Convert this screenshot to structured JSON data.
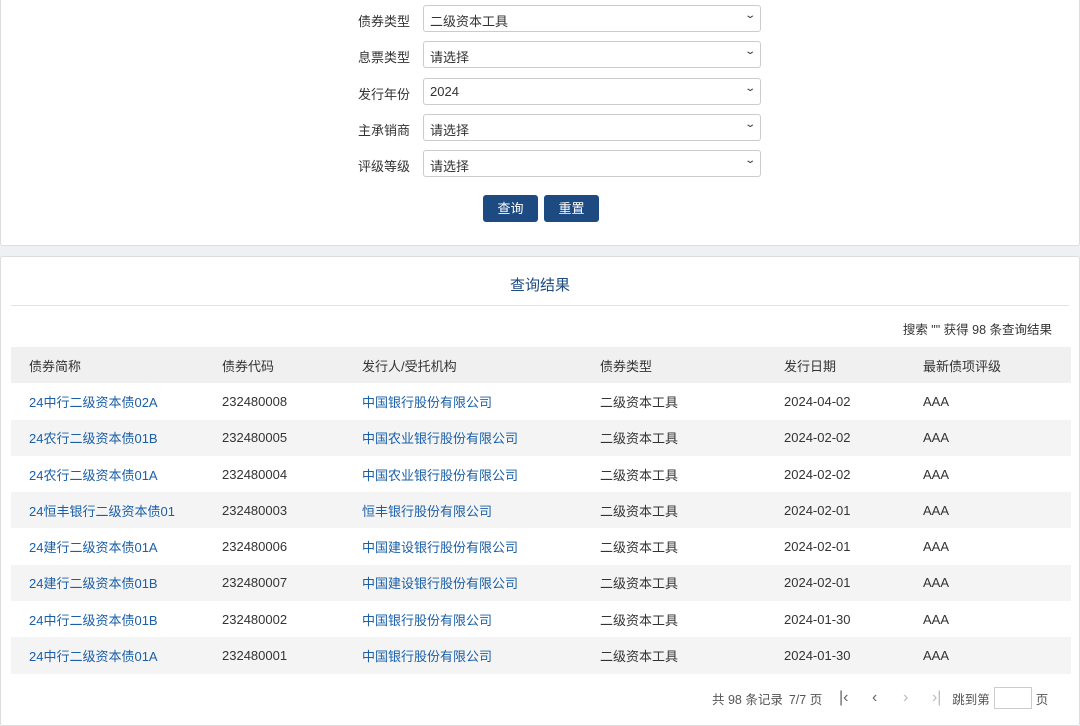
{
  "form": {
    "fields": [
      {
        "label": "债券类型",
        "value": "二级资本工具"
      },
      {
        "label": "息票类型",
        "value": "请选择"
      },
      {
        "label": "发行年份",
        "value": "2024"
      },
      {
        "label": "主承销商",
        "value": "请选择"
      },
      {
        "label": "评级等级",
        "value": "请选择"
      }
    ],
    "query_label": "查询",
    "reset_label": "重置"
  },
  "results": {
    "title": "查询结果",
    "summary": "搜索 \"\" 获得 98 条查询结果",
    "columns": [
      "债券简称",
      "债券代码",
      "发行人/受托机构",
      "债券类型",
      "发行日期",
      "最新债项评级"
    ],
    "rows": [
      [
        "24中行二级资本债02A",
        "232480008",
        "中国银行股份有限公司",
        "二级资本工具",
        "2024-04-02",
        "AAA"
      ],
      [
        "24农行二级资本债01B",
        "232480005",
        "中国农业银行股份有限公司",
        "二级资本工具",
        "2024-02-02",
        "AAA"
      ],
      [
        "24农行二级资本债01A",
        "232480004",
        "中国农业银行股份有限公司",
        "二级资本工具",
        "2024-02-02",
        "AAA"
      ],
      [
        "24恒丰银行二级资本债01",
        "232480003",
        "恒丰银行股份有限公司",
        "二级资本工具",
        "2024-02-01",
        "AAA"
      ],
      [
        "24建行二级资本债01A",
        "232480006",
        "中国建设银行股份有限公司",
        "二级资本工具",
        "2024-02-01",
        "AAA"
      ],
      [
        "24建行二级资本债01B",
        "232480007",
        "中国建设银行股份有限公司",
        "二级资本工具",
        "2024-02-01",
        "AAA"
      ],
      [
        "24中行二级资本债01B",
        "232480002",
        "中国银行股份有限公司",
        "二级资本工具",
        "2024-01-30",
        "AAA"
      ],
      [
        "24中行二级资本债01A",
        "232480001",
        "中国银行股份有限公司",
        "二级资本工具",
        "2024-01-30",
        "AAA"
      ]
    ]
  },
  "pager": {
    "total": "共 98 条记录",
    "page": "7/7 页",
    "jump_label": "跳到第",
    "page_suffix": "页",
    "jump_value": ""
  }
}
